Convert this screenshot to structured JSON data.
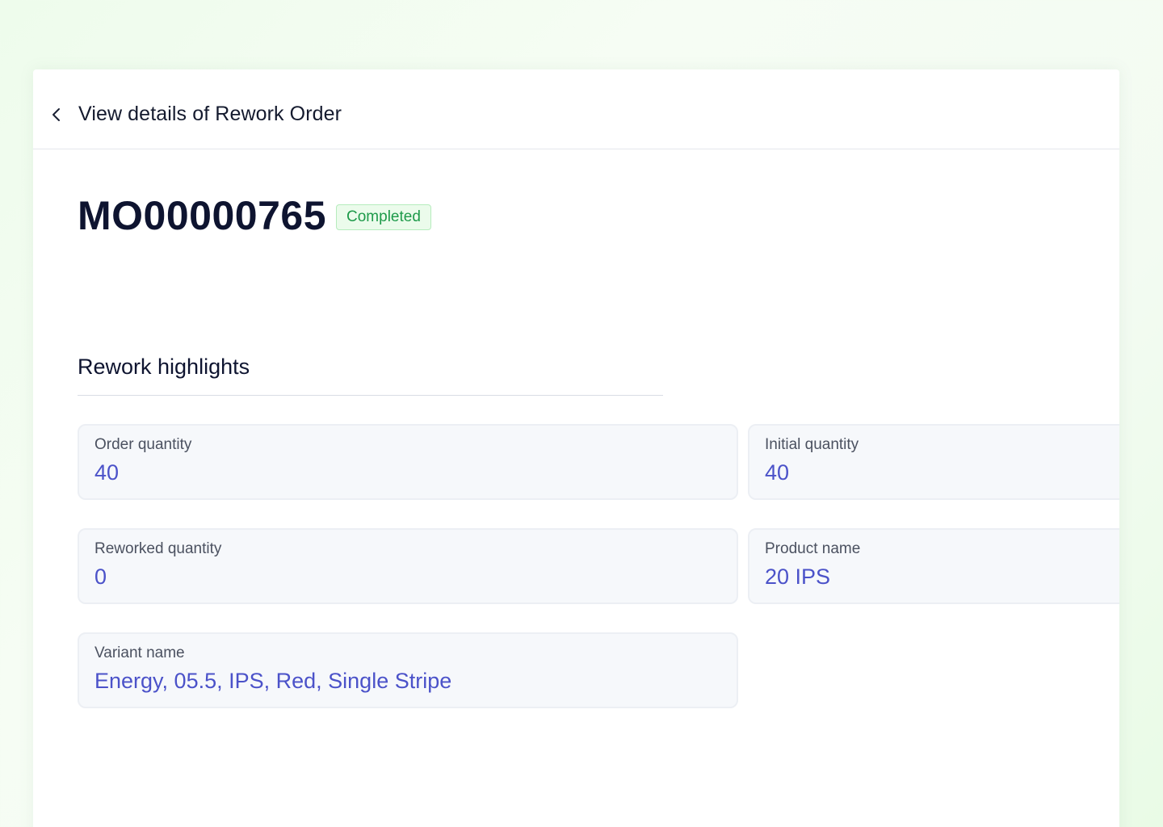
{
  "header": {
    "title": "View details of Rework Order",
    "back_icon": "chevron-left-icon"
  },
  "order": {
    "id": "MO00000765",
    "status": "Completed",
    "status_color": "#1e9a4a"
  },
  "highlights": {
    "title": "Rework highlights",
    "cards": [
      {
        "label": "Order quantity",
        "value": "40"
      },
      {
        "label": "Initial quantity",
        "value": "40"
      },
      {
        "label": "Reworked quantity",
        "value": "0"
      },
      {
        "label": "Product name",
        "value": "20 IPS"
      },
      {
        "label": "Variant name",
        "value": "Energy, 05.5, IPS, Red, Single Stripe"
      }
    ]
  },
  "colors": {
    "accent_value": "#4b52c9",
    "title_text": "#0e1430"
  }
}
